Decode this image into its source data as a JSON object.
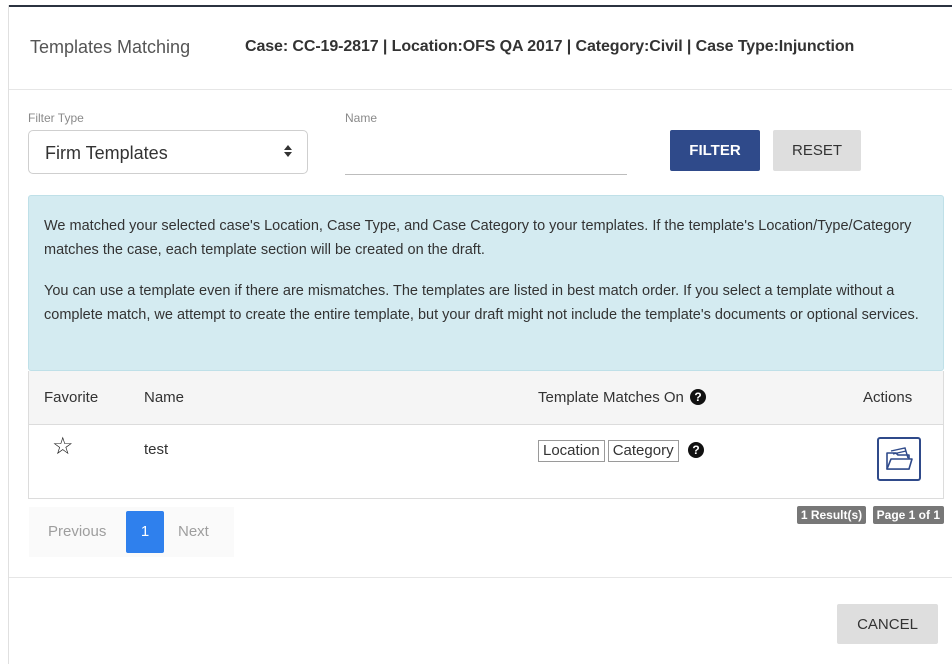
{
  "header": {
    "title": "Templates Matching",
    "case_summary": "Case: CC-19-2817 | Location:OFS QA 2017 | Category:Civil | Case Type:Injunction"
  },
  "filter": {
    "type_label": "Filter Type",
    "type_value": "Firm Templates",
    "name_label": "Name",
    "name_value": "",
    "filter_button": "FILTER",
    "reset_button": "RESET"
  },
  "info": {
    "paragraph1": "We matched your selected case's Location, Case Type, and Case Category to your templates. If the template's Location/Type/Category matches the case, each template section will be created on the draft.",
    "paragraph2": "You can use a template even if there are mismatches. The templates are listed in best match order. If you select a template without a complete match, we attempt to create the entire template, but your draft might not include the template's documents or optional services."
  },
  "table": {
    "columns": {
      "favorite": "Favorite",
      "name": "Name",
      "matches": "Template Matches On",
      "actions": "Actions"
    },
    "rows": [
      {
        "favorite": false,
        "name": "test",
        "matches": [
          "Location",
          "Category"
        ]
      }
    ]
  },
  "results": {
    "count": "1 Result(s)",
    "page": "Page 1 of 1"
  },
  "pagination": {
    "previous": "Previous",
    "current": "1",
    "next": "Next"
  },
  "footer": {
    "cancel_button": "CANCEL"
  },
  "icons": {
    "help": "question-circle-icon",
    "favorite": "star-outline-icon",
    "open_template": "folder-open-icon",
    "select_arrows": "sort-arrows-icon"
  },
  "colors": {
    "primary": "#2f4a8a",
    "info_background": "#d4ebf1",
    "pager_active": "#2f80ed",
    "badge": "#777777"
  }
}
